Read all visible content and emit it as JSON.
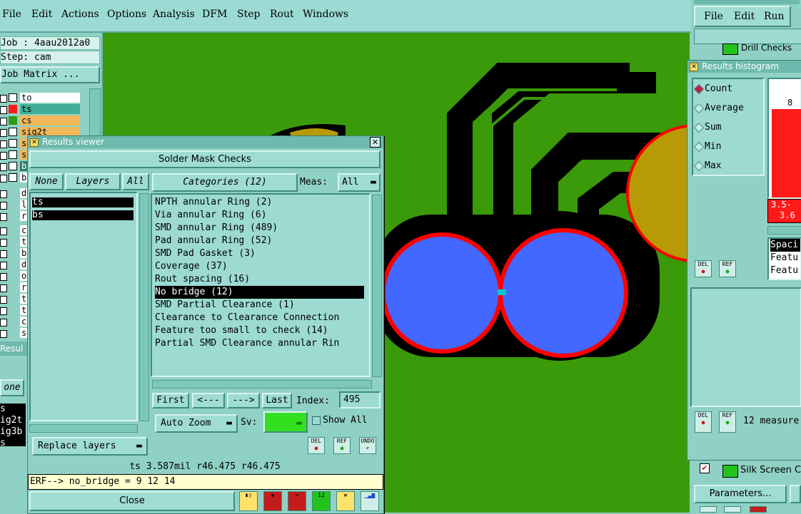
{
  "menubar": {
    "items": [
      "File",
      "Edit",
      "Actions",
      "Options",
      "Analysis",
      "DFM",
      "Step",
      "Rout",
      "Windows"
    ]
  },
  "left_panel": {
    "job": "Job : 4aau2012a0",
    "step": "Step: cam",
    "job_matrix": "Job Matrix ...",
    "layers": [
      {
        "name": "to",
        "color": "#ffffff"
      },
      {
        "name": "ts",
        "color": "#ff1a1a"
      },
      {
        "name": "cs",
        "color": "#2f9a14"
      },
      {
        "name": "sig2t",
        "color": "#ffffff"
      },
      {
        "name": "s",
        "color": "#ffffff"
      },
      {
        "name": "s",
        "color": "#ffffff"
      },
      {
        "name": "b",
        "color": "#ffffff"
      },
      {
        "name": "b",
        "color": "#ffffff"
      }
    ],
    "layers2": [
      "d",
      "l",
      "r"
    ],
    "layers3": [
      "c",
      "t",
      "b",
      "d",
      "o",
      "r",
      "t",
      "t",
      "c",
      "s"
    ],
    "results_label": "Resul",
    "none_btn": "one",
    "bottom_list": [
      "s",
      "ig2t",
      "ig3b",
      "s"
    ]
  },
  "results_viewer": {
    "title": "Results viewer",
    "heading": "Solder Mask Checks",
    "none_btn": "None",
    "layers_btn": "Layers",
    "all_btn": "All",
    "layers": [
      "ts",
      "bs"
    ],
    "categories_btn": "Categories (12)",
    "meas_label": "Meas:",
    "meas_value": "All",
    "categories": [
      "NPTH annular Ring (2)",
      "Via annular Ring (6)",
      "SMD annular Ring (489)",
      "Pad annular Ring (52)",
      "SMD Pad Gasket (3)",
      "Coverage (37)",
      "Rout spacing (16)",
      "No bridge (12)",
      "SMD Partial Clearance (1)",
      "Clearance to Clearance Connection",
      "Feature too small to check (14)",
      "Partial SMD Clearance annular Rin"
    ],
    "selected_category": 7,
    "first_btn": "First",
    "prev_btn": "<---",
    "next_btn": "--->",
    "last_btn": "Last",
    "index_label": "Index:",
    "index_value": "495",
    "auto_zoom": "Auto Zoom",
    "sv_label": "Sv:",
    "show_all": "Show All",
    "replace_layers": "Replace layers",
    "del_label": "DEL",
    "ref_label": "REF",
    "undo_label": "UNDO",
    "status_line": "ts 3.587mil  r46.475  r46.475",
    "erf_line": "ERF--> no_bridge = 9 12 14",
    "close_btn": "Close"
  },
  "right_window": {
    "menu": [
      "File",
      "Edit",
      "Run"
    ],
    "drill_checks": "Drill Checks",
    "hist_title": "Results histogram",
    "radio_options": [
      "Count",
      "Average",
      "Sum",
      "Min",
      "Max"
    ],
    "selected_radio": 0,
    "bar_count": "8",
    "bin_label_1": "3.5-",
    "bin_label_2": "3.6",
    "list_items": [
      "Spaci",
      "Featu",
      "Featu"
    ],
    "del_label": "DEL",
    "ref_label": "REF",
    "measure_text": "12 measure",
    "silk_screen": "Silk Screen C",
    "parameters_btn": "Parameters..."
  },
  "colors": {
    "board": "#3a9a0a",
    "pad": "#4268ff",
    "outline": "#ff0000",
    "mask": "#000000",
    "copper": "#b79a05",
    "bridge": "#00c8c8",
    "bar": "#ff1a1a",
    "ui": "#8fd1c4"
  }
}
